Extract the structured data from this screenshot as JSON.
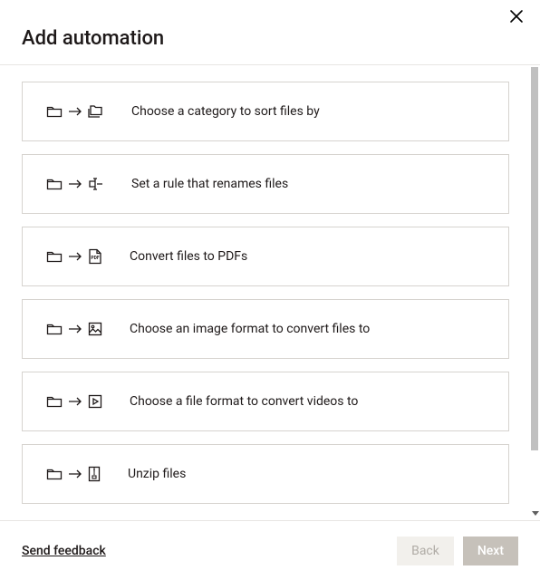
{
  "title": "Add automation",
  "options": [
    {
      "id": "sort-files",
      "label": "Choose a category to sort files by"
    },
    {
      "id": "rename-files",
      "label": "Set a rule that renames files"
    },
    {
      "id": "convert-pdf",
      "label": "Convert files to PDFs"
    },
    {
      "id": "convert-image",
      "label": "Choose an image format to convert files to"
    },
    {
      "id": "convert-video",
      "label": "Choose a file format to convert videos to"
    },
    {
      "id": "unzip",
      "label": "Unzip files"
    }
  ],
  "footer": {
    "feedback": "Send feedback",
    "back": "Back",
    "next": "Next"
  }
}
